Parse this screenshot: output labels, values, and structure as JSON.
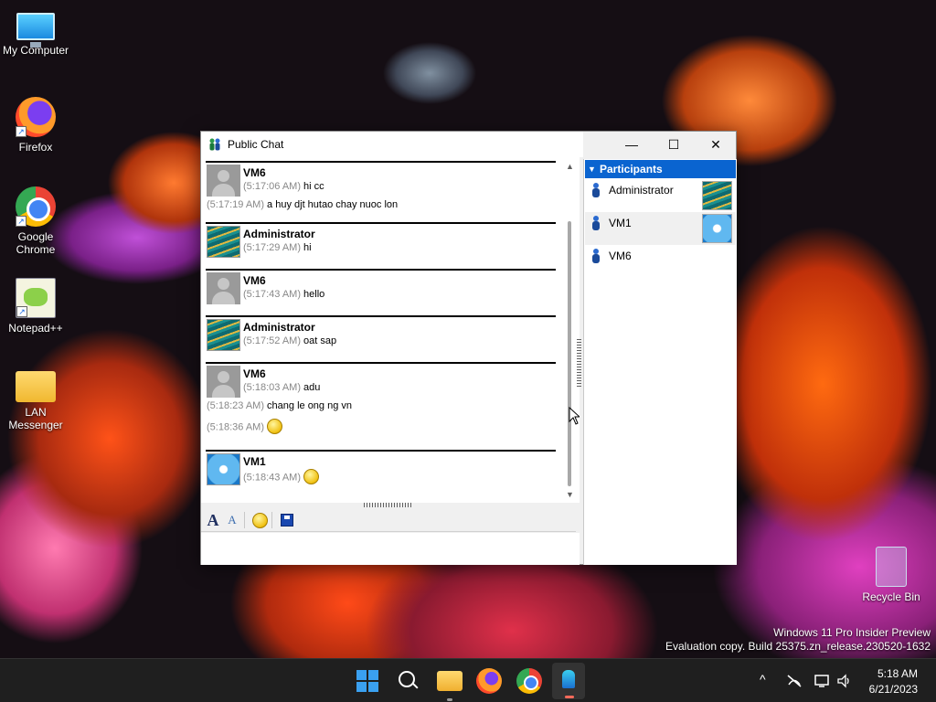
{
  "desktop": {
    "icons": [
      {
        "label": "My Computer"
      },
      {
        "label": "Firefox"
      },
      {
        "label": "Google Chrome"
      },
      {
        "label": "Notepad++"
      },
      {
        "label": "LAN Messenger"
      },
      {
        "label": "Recycle Bin"
      }
    ],
    "watermark": {
      "line1": "Windows 11 Pro Insider Preview",
      "line2": "Evaluation copy. Build 25375.zn_release.230520-1632"
    }
  },
  "window": {
    "title": "Public Chat",
    "controls": {
      "minimize": "—",
      "maximize": "☐",
      "close": "✕"
    }
  },
  "chat": {
    "messages": [
      {
        "sender": "VM6",
        "lines": [
          {
            "time": "(5:17:06 AM)",
            "text": "hi cc"
          },
          {
            "time": "(5:17:19 AM)",
            "text": "a huy djt hutao chay nuoc lon"
          }
        ]
      },
      {
        "sender": "Administrator",
        "lines": [
          {
            "time": "(5:17:29 AM)",
            "text": "hi"
          }
        ]
      },
      {
        "sender": "VM6",
        "lines": [
          {
            "time": "(5:17:43 AM)",
            "text": "hello"
          }
        ]
      },
      {
        "sender": "Administrator",
        "lines": [
          {
            "time": "(5:17:52 AM)",
            "text": "oat sap"
          }
        ]
      },
      {
        "sender": "VM6",
        "lines": [
          {
            "time": "(5:18:03 AM)",
            "text": "adu"
          },
          {
            "time": "(5:18:23 AM)",
            "text": "chang le ong ng vn"
          },
          {
            "time": "(5:18:36 AM)",
            "text": ""
          }
        ]
      },
      {
        "sender": "VM1",
        "lines": [
          {
            "time": "(5:18:43 AM)",
            "text": ""
          }
        ]
      }
    ]
  },
  "toolbar": {
    "font_glyph": "A",
    "style_glyph": "A"
  },
  "participants": {
    "header": "Participants",
    "items": [
      {
        "name": "Administrator"
      },
      {
        "name": "VM1"
      },
      {
        "name": "VM6"
      }
    ]
  },
  "taskbar": {
    "tray_chevron": "^",
    "clock_time": "5:18 AM",
    "clock_date": "6/21/2023"
  }
}
